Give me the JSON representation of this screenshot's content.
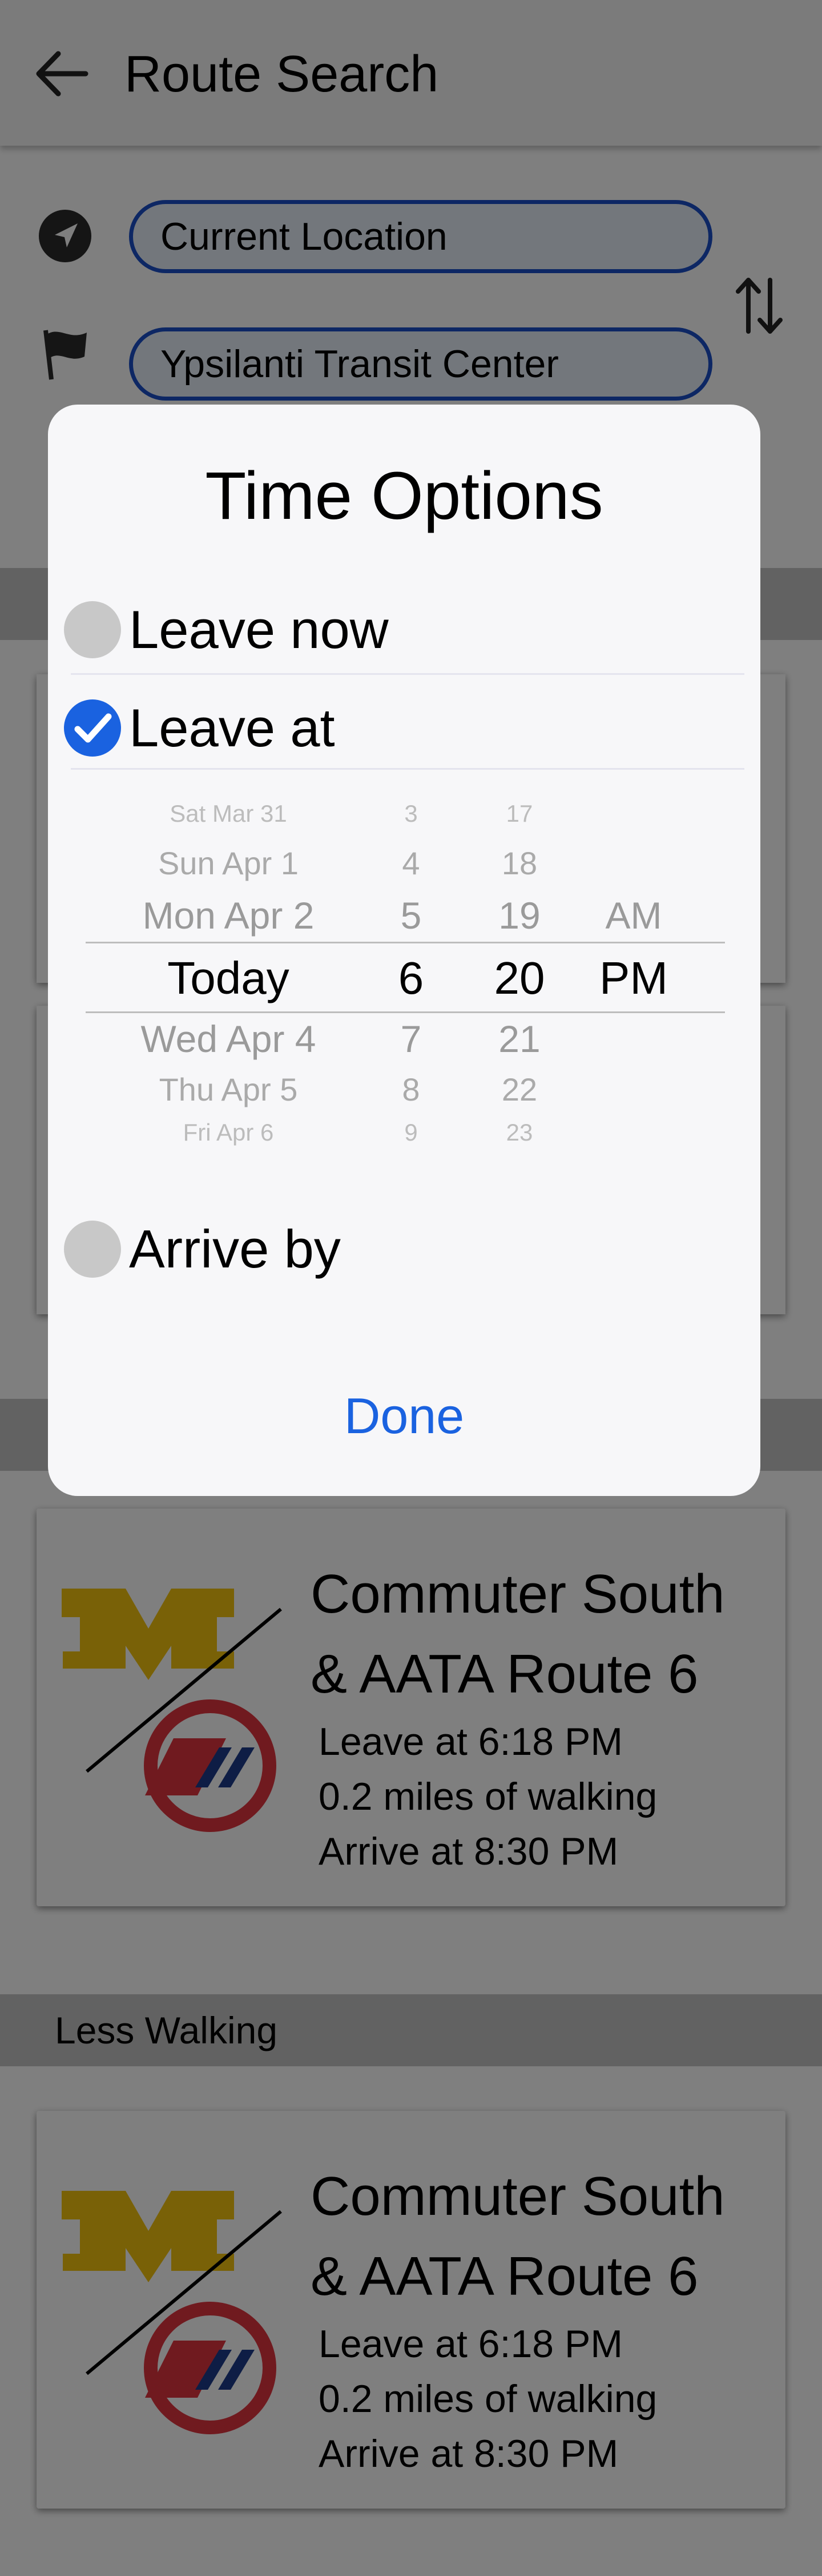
{
  "header": {
    "title": "Route Search"
  },
  "search": {
    "origin": "Current Location",
    "destination": "Ypsilanti Transit Center"
  },
  "sections": [
    {
      "label": "Less Walking"
    }
  ],
  "cards": [
    {
      "route_line1": "Commuter South",
      "route_line2": "& AATA Route 6",
      "leave": "Leave at 6:18 PM",
      "walking": "0.2 miles of walking",
      "arrive": "Arrive at 8:30 PM"
    },
    {
      "route_line1": "Commuter South",
      "route_line2": "& AATA Route 6",
      "leave": "Leave at 6:18 PM",
      "walking": "0.2 miles of walking",
      "arrive": "Arrive at 8:30 PM"
    }
  ],
  "dialog": {
    "title": "Time Options",
    "options": [
      {
        "label": "Leave now",
        "selected": false
      },
      {
        "label": "Leave at",
        "selected": true
      },
      {
        "label": "Arrive by",
        "selected": false
      }
    ],
    "picker": {
      "dates": [
        "Sat Mar 31",
        "Sun Apr 1",
        "Mon Apr 2",
        "Today",
        "Wed Apr 4",
        "Thu Apr 5",
        "Fri Apr 6"
      ],
      "hours": [
        "3",
        "4",
        "5",
        "6",
        "7",
        "8",
        "9"
      ],
      "minutes": [
        "17",
        "18",
        "19",
        "20",
        "21",
        "22",
        "23"
      ],
      "ampm": [
        "AM",
        "PM"
      ],
      "selected": {
        "date": "Today",
        "hour": "6",
        "minute": "20",
        "ampm": "PM"
      }
    },
    "done_label": "Done"
  },
  "colors": {
    "accent": "#1a62e0",
    "pill_border": "#1a4fc9",
    "michigan_maize": "#f2c20f",
    "aata_red": "#e0343f",
    "aata_blue": "#1d3a8a"
  },
  "icons": [
    "back-arrow-icon",
    "navigation-arrow-icon",
    "flag-icon",
    "swap-icon",
    "checkmark-icon"
  ]
}
